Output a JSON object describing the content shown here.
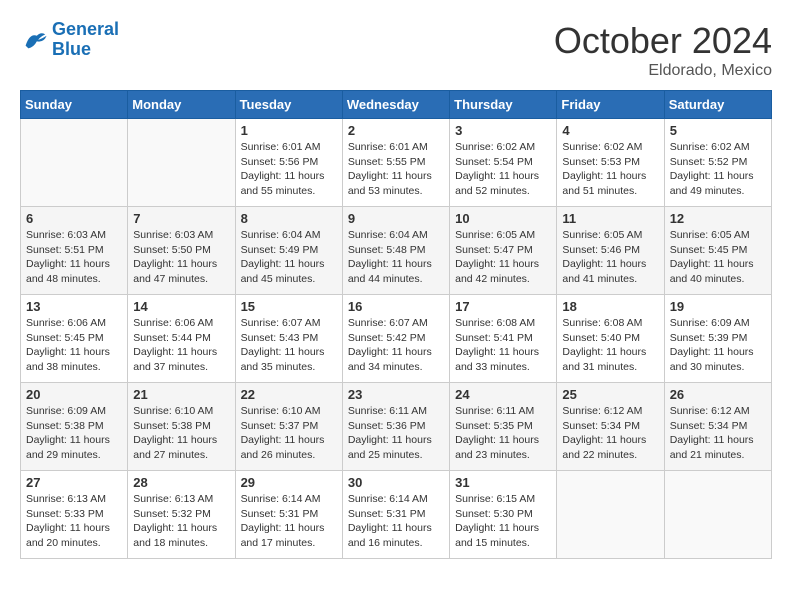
{
  "logo": {
    "line1": "General",
    "line2": "Blue"
  },
  "title": "October 2024",
  "subtitle": "Eldorado, Mexico",
  "days_header": [
    "Sunday",
    "Monday",
    "Tuesday",
    "Wednesday",
    "Thursday",
    "Friday",
    "Saturday"
  ],
  "weeks": [
    [
      {
        "num": "",
        "info": ""
      },
      {
        "num": "",
        "info": ""
      },
      {
        "num": "1",
        "info": "Sunrise: 6:01 AM\nSunset: 5:56 PM\nDaylight: 11 hours and 55 minutes."
      },
      {
        "num": "2",
        "info": "Sunrise: 6:01 AM\nSunset: 5:55 PM\nDaylight: 11 hours and 53 minutes."
      },
      {
        "num": "3",
        "info": "Sunrise: 6:02 AM\nSunset: 5:54 PM\nDaylight: 11 hours and 52 minutes."
      },
      {
        "num": "4",
        "info": "Sunrise: 6:02 AM\nSunset: 5:53 PM\nDaylight: 11 hours and 51 minutes."
      },
      {
        "num": "5",
        "info": "Sunrise: 6:02 AM\nSunset: 5:52 PM\nDaylight: 11 hours and 49 minutes."
      }
    ],
    [
      {
        "num": "6",
        "info": "Sunrise: 6:03 AM\nSunset: 5:51 PM\nDaylight: 11 hours and 48 minutes."
      },
      {
        "num": "7",
        "info": "Sunrise: 6:03 AM\nSunset: 5:50 PM\nDaylight: 11 hours and 47 minutes."
      },
      {
        "num": "8",
        "info": "Sunrise: 6:04 AM\nSunset: 5:49 PM\nDaylight: 11 hours and 45 minutes."
      },
      {
        "num": "9",
        "info": "Sunrise: 6:04 AM\nSunset: 5:48 PM\nDaylight: 11 hours and 44 minutes."
      },
      {
        "num": "10",
        "info": "Sunrise: 6:05 AM\nSunset: 5:47 PM\nDaylight: 11 hours and 42 minutes."
      },
      {
        "num": "11",
        "info": "Sunrise: 6:05 AM\nSunset: 5:46 PM\nDaylight: 11 hours and 41 minutes."
      },
      {
        "num": "12",
        "info": "Sunrise: 6:05 AM\nSunset: 5:45 PM\nDaylight: 11 hours and 40 minutes."
      }
    ],
    [
      {
        "num": "13",
        "info": "Sunrise: 6:06 AM\nSunset: 5:45 PM\nDaylight: 11 hours and 38 minutes."
      },
      {
        "num": "14",
        "info": "Sunrise: 6:06 AM\nSunset: 5:44 PM\nDaylight: 11 hours and 37 minutes."
      },
      {
        "num": "15",
        "info": "Sunrise: 6:07 AM\nSunset: 5:43 PM\nDaylight: 11 hours and 35 minutes."
      },
      {
        "num": "16",
        "info": "Sunrise: 6:07 AM\nSunset: 5:42 PM\nDaylight: 11 hours and 34 minutes."
      },
      {
        "num": "17",
        "info": "Sunrise: 6:08 AM\nSunset: 5:41 PM\nDaylight: 11 hours and 33 minutes."
      },
      {
        "num": "18",
        "info": "Sunrise: 6:08 AM\nSunset: 5:40 PM\nDaylight: 11 hours and 31 minutes."
      },
      {
        "num": "19",
        "info": "Sunrise: 6:09 AM\nSunset: 5:39 PM\nDaylight: 11 hours and 30 minutes."
      }
    ],
    [
      {
        "num": "20",
        "info": "Sunrise: 6:09 AM\nSunset: 5:38 PM\nDaylight: 11 hours and 29 minutes."
      },
      {
        "num": "21",
        "info": "Sunrise: 6:10 AM\nSunset: 5:38 PM\nDaylight: 11 hours and 27 minutes."
      },
      {
        "num": "22",
        "info": "Sunrise: 6:10 AM\nSunset: 5:37 PM\nDaylight: 11 hours and 26 minutes."
      },
      {
        "num": "23",
        "info": "Sunrise: 6:11 AM\nSunset: 5:36 PM\nDaylight: 11 hours and 25 minutes."
      },
      {
        "num": "24",
        "info": "Sunrise: 6:11 AM\nSunset: 5:35 PM\nDaylight: 11 hours and 23 minutes."
      },
      {
        "num": "25",
        "info": "Sunrise: 6:12 AM\nSunset: 5:34 PM\nDaylight: 11 hours and 22 minutes."
      },
      {
        "num": "26",
        "info": "Sunrise: 6:12 AM\nSunset: 5:34 PM\nDaylight: 11 hours and 21 minutes."
      }
    ],
    [
      {
        "num": "27",
        "info": "Sunrise: 6:13 AM\nSunset: 5:33 PM\nDaylight: 11 hours and 20 minutes."
      },
      {
        "num": "28",
        "info": "Sunrise: 6:13 AM\nSunset: 5:32 PM\nDaylight: 11 hours and 18 minutes."
      },
      {
        "num": "29",
        "info": "Sunrise: 6:14 AM\nSunset: 5:31 PM\nDaylight: 11 hours and 17 minutes."
      },
      {
        "num": "30",
        "info": "Sunrise: 6:14 AM\nSunset: 5:31 PM\nDaylight: 11 hours and 16 minutes."
      },
      {
        "num": "31",
        "info": "Sunrise: 6:15 AM\nSunset: 5:30 PM\nDaylight: 11 hours and 15 minutes."
      },
      {
        "num": "",
        "info": ""
      },
      {
        "num": "",
        "info": ""
      }
    ]
  ]
}
